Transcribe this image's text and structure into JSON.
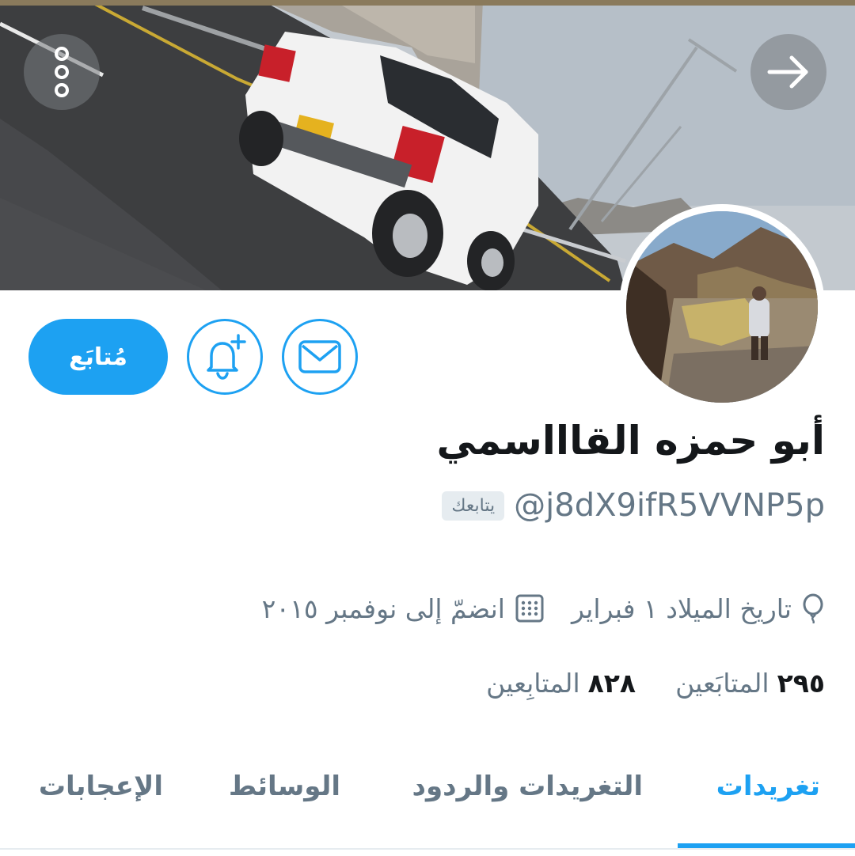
{
  "header": {
    "more_icon": "more-vertical-icon",
    "back_icon": "arrow-right-icon"
  },
  "profile": {
    "name": "أبو حمزه القاااسمي",
    "handle": "@j8dX9ifR5VVNP5p",
    "follows_you": "يتابعك",
    "birthday": "تاريخ الميلاد ١ فبراير",
    "joined": "انضمّ إلى نوفمبر ٢٠١٥"
  },
  "actions": {
    "follow_label": "مُتابَع",
    "notify_icon": "bell-plus-icon",
    "message_icon": "mail-icon"
  },
  "stats": {
    "following_count": "٢٩٥",
    "following_label": "المتابَعين",
    "followers_count": "٨٢٨",
    "followers_label": "المتابِعين"
  },
  "tabs": [
    {
      "label": "تغريدات",
      "active": true
    },
    {
      "label": "التغريدات والردود",
      "active": false
    },
    {
      "label": "الوسائط",
      "active": false
    },
    {
      "label": "الإعجابات",
      "active": false
    }
  ],
  "colors": {
    "accent": "#1da1f2",
    "secondary_text": "#657786",
    "primary_text": "#14171a"
  }
}
